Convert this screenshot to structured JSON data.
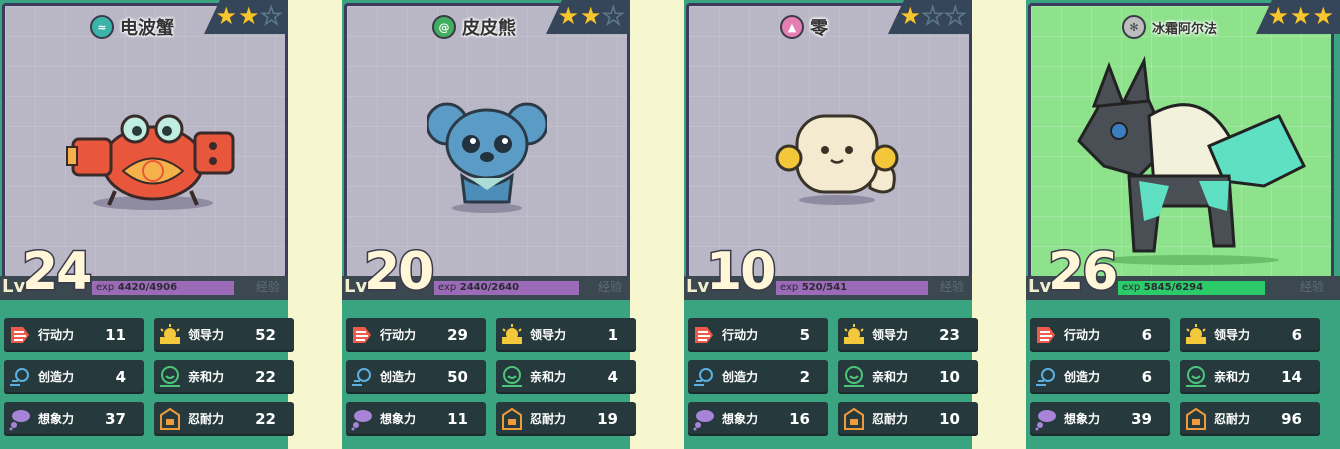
{
  "cards": [
    {
      "name": "电波蟹",
      "type_icon": "electric-wave-icon",
      "type_color": "#3bb3a8",
      "stars": 2,
      "level": "24",
      "exp_current": "4420",
      "exp_max": "4906",
      "exp_fill_fraction": 0.9,
      "exp_color": "#9b6bb8",
      "stats": {
        "action": "11",
        "leadership": "52",
        "creativity": "4",
        "affinity": "22",
        "imagination": "37",
        "endurance": "22"
      }
    },
    {
      "name": "皮皮熊",
      "type_icon": "leaf-swirl-icon",
      "type_color": "#3fae5e",
      "stars": 2,
      "level": "20",
      "exp_current": "2440",
      "exp_max": "2640",
      "exp_fill_fraction": 0.92,
      "exp_color": "#9b6bb8",
      "stats": {
        "action": "29",
        "leadership": "1",
        "creativity": "50",
        "affinity": "4",
        "imagination": "11",
        "endurance": "19"
      }
    },
    {
      "name": "零",
      "type_icon": "pink-triangle-icon",
      "type_color": "#e57fb1",
      "stars": 1,
      "level": "10",
      "exp_current": "520",
      "exp_max": "541",
      "exp_fill_fraction": 0.96,
      "exp_color": "#9b6bb8",
      "stats": {
        "action": "5",
        "leadership": "23",
        "creativity": "2",
        "affinity": "10",
        "imagination": "16",
        "endurance": "10"
      }
    },
    {
      "name": "冰霜阿尔法",
      "type_icon": "snowflake-icon",
      "type_color": "#bdbdbd",
      "stars": 3,
      "level": "26",
      "exp_current": "5845",
      "exp_max": "6294",
      "exp_fill_fraction": 0.93,
      "exp_color": "#2ccb6a",
      "stats": {
        "action": "6",
        "leadership": "6",
        "creativity": "6",
        "affinity": "14",
        "imagination": "39",
        "endurance": "96"
      }
    }
  ],
  "labels": {
    "lv": "Lv",
    "exp": "exp",
    "exp_cn": "经验",
    "action": "行动力",
    "leadership": "领导力",
    "creativity": "创造力",
    "affinity": "亲和力",
    "imagination": "想象力",
    "endurance": "忍耐力"
  }
}
